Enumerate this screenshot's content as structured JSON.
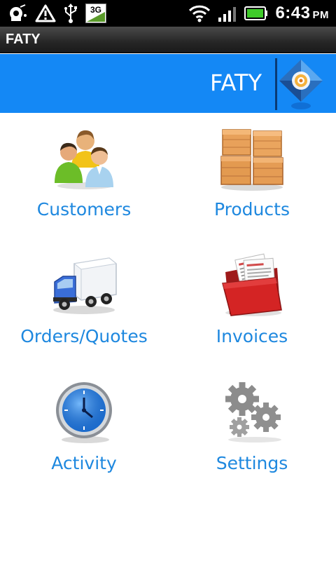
{
  "status_bar": {
    "time": "6:43",
    "ampm": "PM",
    "network_badge": "3G",
    "icons": [
      "satellite-icon",
      "warning-icon",
      "usb-icon",
      "3g-icon",
      "wifi-icon",
      "signal-icon",
      "battery-icon"
    ]
  },
  "app": {
    "title_bar": "FATY",
    "header_title": "FATY"
  },
  "colors": {
    "header_blue": "#1488f5",
    "label_blue": "#1e88df"
  },
  "menu": [
    {
      "label": "Customers",
      "icon": "customers-icon"
    },
    {
      "label": "Products",
      "icon": "products-icon"
    },
    {
      "label": "Orders/Quotes",
      "icon": "truck-icon"
    },
    {
      "label": "Invoices",
      "icon": "invoice-folder-icon"
    },
    {
      "label": "Activity",
      "icon": "clock-icon"
    },
    {
      "label": "Settings",
      "icon": "gears-icon"
    }
  ]
}
